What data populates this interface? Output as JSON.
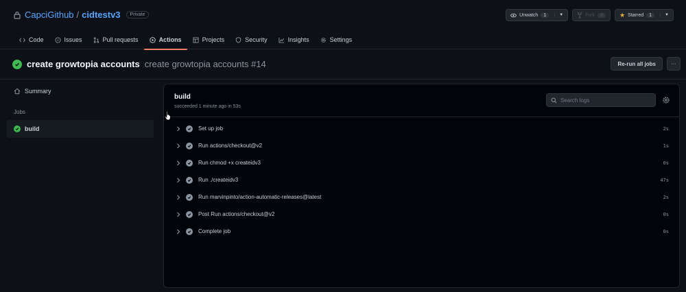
{
  "repo": {
    "owner": "CapciGithub",
    "separator": "/",
    "name": "cidtestv3",
    "visibility": "Private"
  },
  "header_actions": {
    "watch": {
      "label": "Unwatch",
      "count": "1",
      "icon": "eye-icon"
    },
    "fork": {
      "label": "Fork",
      "count": "0",
      "icon": "fork-icon"
    },
    "star": {
      "label": "Starred",
      "count": "1",
      "icon": "star-icon"
    }
  },
  "tabs": [
    {
      "label": "Code",
      "icon": "code-icon"
    },
    {
      "label": "Issues",
      "icon": "issue-icon"
    },
    {
      "label": "Pull requests",
      "icon": "pull-request-icon"
    },
    {
      "label": "Actions",
      "icon": "play-icon",
      "active": true
    },
    {
      "label": "Projects",
      "icon": "table-icon"
    },
    {
      "label": "Security",
      "icon": "shield-icon"
    },
    {
      "label": "Insights",
      "icon": "graph-icon"
    },
    {
      "label": "Settings",
      "icon": "gear-icon"
    }
  ],
  "run": {
    "workflow": "create growtopia accounts",
    "title": "create growtopia accounts #14",
    "status": "success",
    "rerun_label": "Re-run all jobs"
  },
  "sidebar": {
    "summary_label": "Summary",
    "jobs_heading": "Jobs",
    "job_label": "build"
  },
  "job": {
    "name": "build",
    "meta": "succeeded 1 minute ago in 53s",
    "search_placeholder": "Search logs",
    "steps": [
      {
        "label": "Set up job",
        "duration": "2s"
      },
      {
        "label": "Run actions/checkout@v2",
        "duration": "1s"
      },
      {
        "label": "Run chmod +x createidv3",
        "duration": "0s"
      },
      {
        "label": "Run ./createidv3",
        "duration": "47s"
      },
      {
        "label": "Run marvinpinto/action-automatic-releases@latest",
        "duration": "2s"
      },
      {
        "label": "Post Run actions/checkout@v2",
        "duration": "0s"
      },
      {
        "label": "Complete job",
        "duration": "0s"
      }
    ]
  },
  "colors": {
    "success": "#3fb950",
    "link": "#58a6ff",
    "tab_underline": "#f78166",
    "star": "#e3b341"
  }
}
